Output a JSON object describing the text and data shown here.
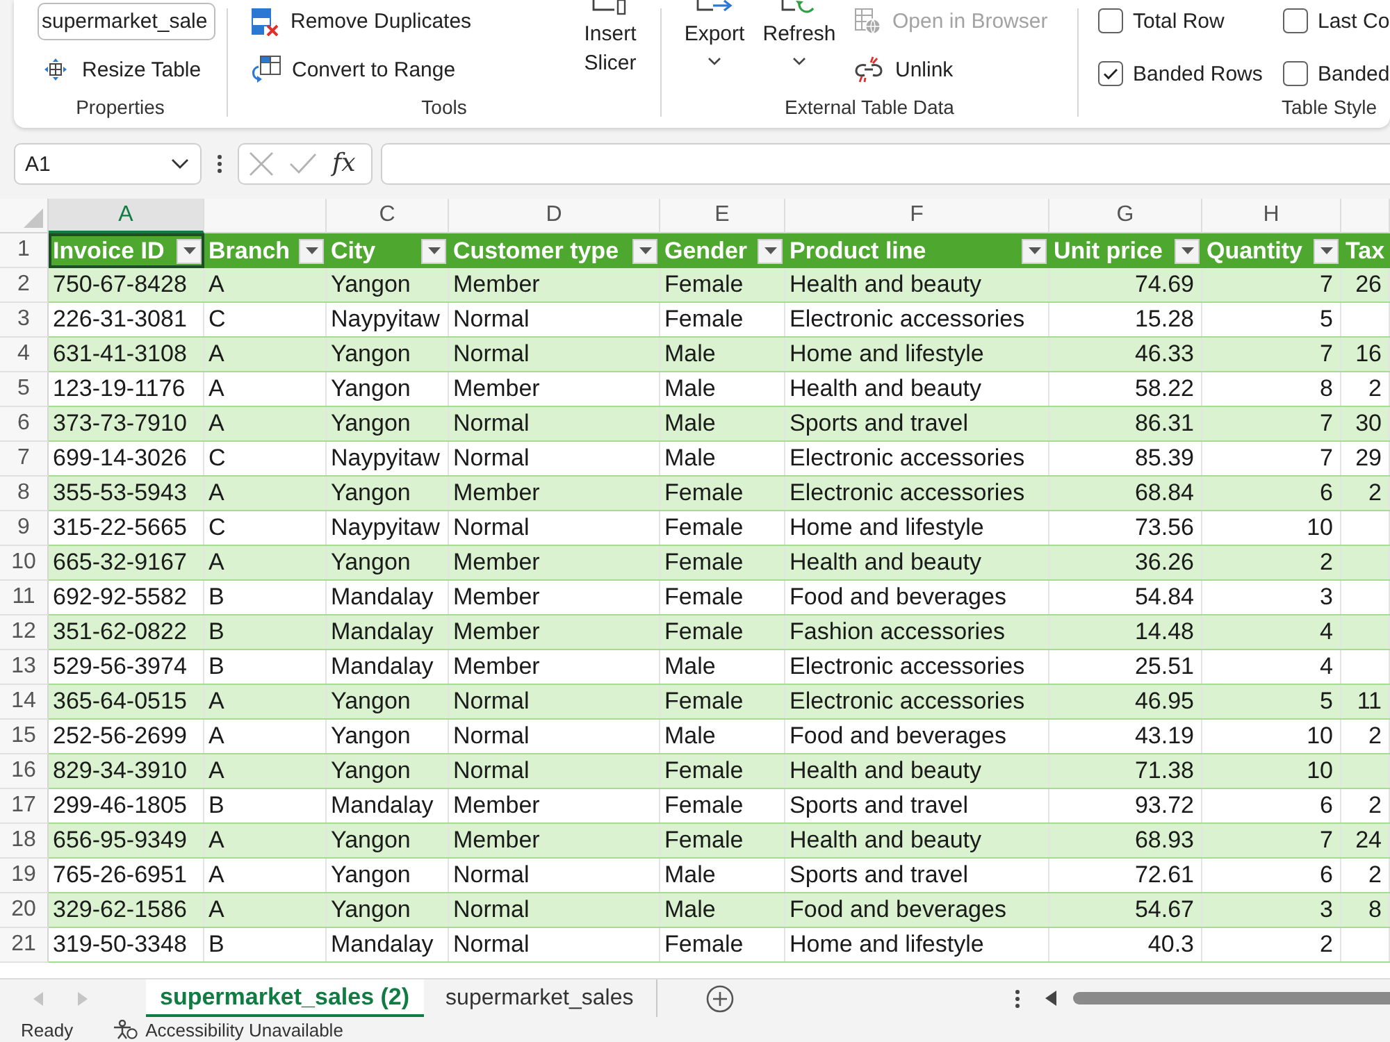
{
  "ribbon": {
    "properties": {
      "label": "Properties",
      "table_name": "supermarket_sale",
      "resize_table": "Resize Table"
    },
    "tools": {
      "label": "Tools",
      "remove_duplicates": "Remove Duplicates",
      "convert_to_range": "Convert to Range",
      "insert_slicer": "Insert Slicer"
    },
    "external_table_data": {
      "label": "External Table Data",
      "export": "Export",
      "refresh": "Refresh",
      "open_in_browser": {
        "label": "Open in Browser",
        "disabled": true
      },
      "unlink": {
        "label": "Unlink",
        "disabled": false
      }
    },
    "table_style_options": {
      "label": "Table Style",
      "options": [
        {
          "label": "Total Row",
          "checked": false
        },
        {
          "label": "Last Co",
          "checked": false
        },
        {
          "label": "Banded Rows",
          "checked": true
        },
        {
          "label": "Banded",
          "checked": false
        }
      ]
    }
  },
  "formula_bar": {
    "name_box": "A1",
    "function_label": "fx"
  },
  "sheet": {
    "columns": [
      {
        "letter": "A",
        "selected": true
      },
      {
        "selected": false
      },
      {
        "letter": "C",
        "selected": false
      },
      {
        "letter": "D",
        "selected": false
      },
      {
        "letter": "E",
        "selected": false
      },
      {
        "letter": "F",
        "selected": false
      },
      {
        "letter": "G",
        "selected": false
      },
      {
        "letter": "H",
        "selected": false
      },
      {
        "selected": false
      }
    ],
    "header_row": {
      "number": "1",
      "cells": [
        {
          "label": "Invoice ID",
          "filter": true
        },
        {
          "label": "Branch",
          "filter": true
        },
        {
          "label": "City",
          "filter": true
        },
        {
          "label": "Customer type",
          "filter": true
        },
        {
          "label": "Gender",
          "filter": true
        },
        {
          "label": "Product line",
          "filter": true
        },
        {
          "label": "Unit price",
          "filter": true
        },
        {
          "label": "Quantity",
          "filter": true
        },
        {
          "label": "Tax",
          "filter": false
        }
      ]
    },
    "rows": [
      {
        "number": "2",
        "cells": [
          "750-67-8428",
          "A",
          "Yangon",
          "Member",
          "Female",
          "Health and beauty",
          "74.69",
          "7",
          "26"
        ]
      },
      {
        "number": "3",
        "cells": [
          "226-31-3081",
          "C",
          "Naypyitaw",
          "Normal",
          "Female",
          "Electronic accessories",
          "15.28",
          "5"
        ]
      },
      {
        "number": "4",
        "cells": [
          "631-41-3108",
          "A",
          "Yangon",
          "Normal",
          "Male",
          "Home and lifestyle",
          "46.33",
          "7",
          "16"
        ]
      },
      {
        "number": "5",
        "cells": [
          "123-19-1176",
          "A",
          "Yangon",
          "Member",
          "Male",
          "Health and beauty",
          "58.22",
          "8",
          "2"
        ]
      },
      {
        "number": "6",
        "cells": [
          "373-73-7910",
          "A",
          "Yangon",
          "Normal",
          "Male",
          "Sports and travel",
          "86.31",
          "7",
          "30"
        ]
      },
      {
        "number": "7",
        "cells": [
          "699-14-3026",
          "C",
          "Naypyitaw",
          "Normal",
          "Male",
          "Electronic accessories",
          "85.39",
          "7",
          "29"
        ]
      },
      {
        "number": "8",
        "cells": [
          "355-53-5943",
          "A",
          "Yangon",
          "Member",
          "Female",
          "Electronic accessories",
          "68.84",
          "6",
          "2"
        ]
      },
      {
        "number": "9",
        "cells": [
          "315-22-5665",
          "C",
          "Naypyitaw",
          "Normal",
          "Female",
          "Home and lifestyle",
          "73.56",
          "10"
        ]
      },
      {
        "number": "10",
        "cells": [
          "665-32-9167",
          "A",
          "Yangon",
          "Member",
          "Female",
          "Health and beauty",
          "36.26",
          "2"
        ]
      },
      {
        "number": "11",
        "cells": [
          "692-92-5582",
          "B",
          "Mandalay",
          "Member",
          "Female",
          "Food and beverages",
          "54.84",
          "3"
        ]
      },
      {
        "number": "12",
        "cells": [
          "351-62-0822",
          "B",
          "Mandalay",
          "Member",
          "Female",
          "Fashion accessories",
          "14.48",
          "4"
        ]
      },
      {
        "number": "13",
        "cells": [
          "529-56-3974",
          "B",
          "Mandalay",
          "Member",
          "Male",
          "Electronic accessories",
          "25.51",
          "4"
        ]
      },
      {
        "number": "14",
        "cells": [
          "365-64-0515",
          "A",
          "Yangon",
          "Normal",
          "Female",
          "Electronic accessories",
          "46.95",
          "5",
          "11"
        ]
      },
      {
        "number": "15",
        "cells": [
          "252-56-2699",
          "A",
          "Yangon",
          "Normal",
          "Male",
          "Food and beverages",
          "43.19",
          "10",
          "2"
        ]
      },
      {
        "number": "16",
        "cells": [
          "829-34-3910",
          "A",
          "Yangon",
          "Normal",
          "Female",
          "Health and beauty",
          "71.38",
          "10"
        ]
      },
      {
        "number": "17",
        "cells": [
          "299-46-1805",
          "B",
          "Mandalay",
          "Member",
          "Female",
          "Sports and travel",
          "93.72",
          "6",
          "2"
        ]
      },
      {
        "number": "18",
        "cells": [
          "656-95-9349",
          "A",
          "Yangon",
          "Member",
          "Female",
          "Health and beauty",
          "68.93",
          "7",
          "24"
        ]
      },
      {
        "number": "19",
        "cells": [
          "765-26-6951",
          "A",
          "Yangon",
          "Normal",
          "Male",
          "Sports and travel",
          "72.61",
          "6",
          "2"
        ]
      },
      {
        "number": "20",
        "cells": [
          "329-62-1586",
          "A",
          "Yangon",
          "Normal",
          "Male",
          "Food and beverages",
          "54.67",
          "3",
          "8"
        ]
      },
      {
        "number": "21",
        "cells": [
          "319-50-3348",
          "B",
          "Mandalay",
          "Normal",
          "Female",
          "Home and lifestyle",
          "40.3",
          "2"
        ]
      }
    ]
  },
  "sheet_tabs": [
    {
      "label": "supermarket_sales (2)",
      "selected": true
    },
    {
      "label": "supermarket_sales",
      "selected": false
    }
  ],
  "status_bar": {
    "mode": "Ready",
    "accessibility": "Accessibility Unavailable"
  }
}
